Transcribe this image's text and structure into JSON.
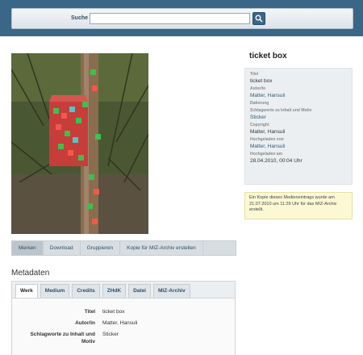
{
  "search": {
    "label": "Suche",
    "value": "",
    "placeholder": ""
  },
  "media": {
    "image_alt": "Foto: ticket box"
  },
  "actions": [
    "Merken",
    "Download",
    "Gruppieren",
    "Kopie für MIZ-Archiv erstellen"
  ],
  "metadata": {
    "title": "Metadaten",
    "tabs": [
      "Werk",
      "Medium",
      "Credits",
      "ZHdK",
      "Datei",
      "MIZ-Archiv"
    ],
    "rows": [
      {
        "label": "Titel",
        "value": "ticket box"
      },
      {
        "label": "Autor/in",
        "value": "Matter, Hansuli"
      },
      {
        "label": "Schlagworte zu Inhalt und",
        "label2": "Motiv",
        "value": "Sticker"
      }
    ]
  },
  "sidebar": {
    "title": "ticket box",
    "fields": [
      {
        "label": "Titel",
        "value": "ticket box",
        "link": false
      },
      {
        "label": "Autor/in",
        "value": "Matter, Hansuli",
        "link": true
      },
      {
        "label": "Datierung",
        "value": "",
        "link": false
      },
      {
        "label": "Schlagworte zu Inhalt und Motiv",
        "value": "Sticker",
        "link": true
      },
      {
        "label": "Copyright",
        "value": "Matter, Hansuli",
        "link": false
      },
      {
        "label": "Hochgeladen von",
        "value": "Matter, Hansuli",
        "link": true
      },
      {
        "label": "Hochgeladen am",
        "value": "28.04.2010, 00:04 Uhr",
        "link": false
      }
    ],
    "notice": "Ein Kopie dieses Medieneintrags wurde am 21.07.2010 um 11:29 Uhr für das MIZ-Archiv erstellt."
  },
  "colors": {
    "header": "#3a6787",
    "link": "#2d5a7b",
    "notice_bg": "#fbf8d3"
  },
  "icons": {
    "search_button": "magnifier-icon"
  }
}
